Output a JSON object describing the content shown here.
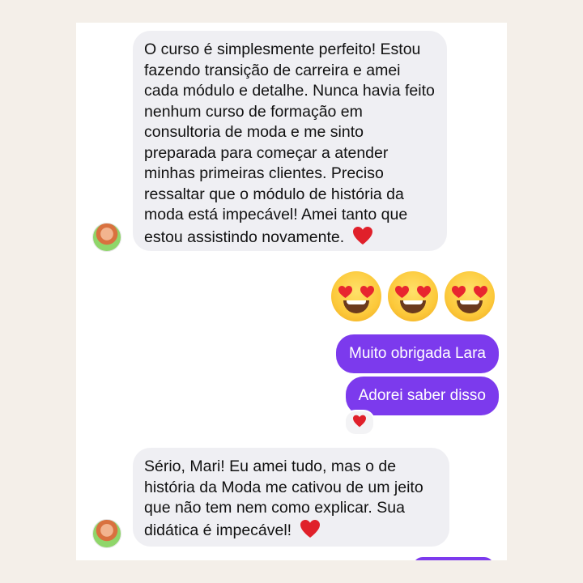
{
  "messages": [
    {
      "from": "contact",
      "text": "O curso é simplesmente perfeito! Estou fazendo transição de carreira e amei cada módulo e detalhe. Nunca havia feito nenhum curso de formação em consultoria de moda e me sinto preparada para começar a atender minhas primeiras clientes. Preciso ressaltar que o módulo de história da moda está impecável!   Amei tanto que estou assistindo novamente.",
      "emoji": "red-heart"
    },
    {
      "from": "me",
      "emojis": [
        "heart-eyes",
        "heart-eyes",
        "heart-eyes"
      ]
    },
    {
      "from": "me",
      "text": "Muito obrigada Lara"
    },
    {
      "from": "me",
      "text": "Adorei saber disso",
      "reaction": "red-heart"
    },
    {
      "from": "contact",
      "text": "Sério, Mari! Eu amei tudo, mas o de história da Moda me cativou de um jeito que não tem nem como explicar. Sua didática é impecável!",
      "emoji": "red-heart"
    }
  ],
  "colors": {
    "outgoing_bubble": "#7c3aed",
    "incoming_bubble": "#efeff3",
    "page_background": "#f4efe9",
    "heart": "#e0202a"
  }
}
